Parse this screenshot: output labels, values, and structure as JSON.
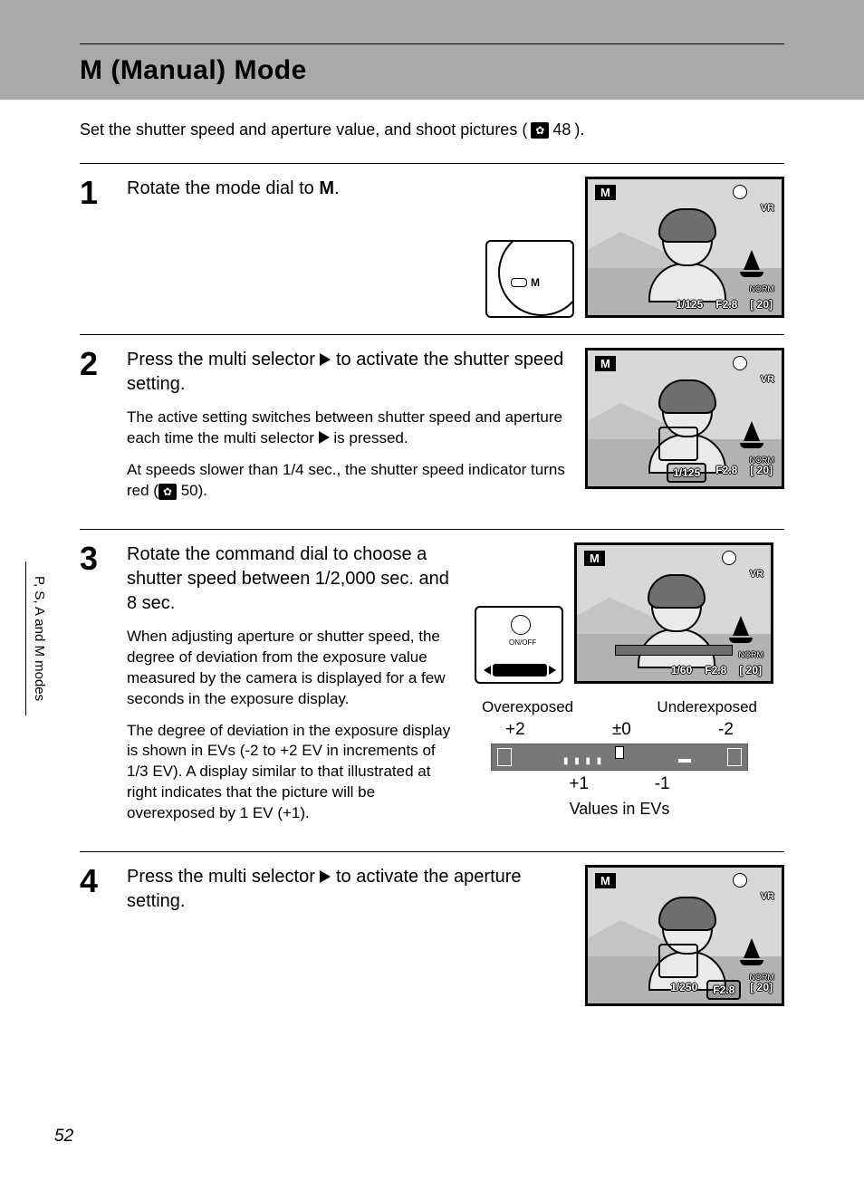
{
  "page": {
    "title": "M (Manual) Mode",
    "intro_a": "Set the shutter speed and aperture value, and shoot pictures (",
    "intro_ref": "48",
    "intro_b": ").",
    "side_tab": "P, S, A and M modes",
    "page_number": "52"
  },
  "steps": [
    {
      "num": "1",
      "title_a": "Rotate the mode dial to ",
      "title_bold": "M",
      "title_b": ".",
      "lcd": {
        "mode": "M",
        "shutter": "1/125",
        "aperture": "F2.8",
        "remain": "20",
        "vr": "VR",
        "norm": "NORM"
      }
    },
    {
      "num": "2",
      "title_a": "Press the multi selector ",
      "title_b": " to activate the shutter speed setting.",
      "desc1_a": "The active setting switches between shutter speed and aperture each time the multi selector ",
      "desc1_b": " is pressed.",
      "desc2_a": "At speeds slower than 1/4 sec., the shutter speed indicator turns red (",
      "desc2_ref": "50",
      "desc2_b": ").",
      "lcd": {
        "mode": "M",
        "shutter": "1/125",
        "aperture": "F2.8",
        "remain": "20",
        "vr": "VR",
        "norm": "NORM",
        "shutter_boxed": true
      }
    },
    {
      "num": "3",
      "title": "Rotate the command dial to choose a shutter speed between 1/2,000 sec. and 8 sec.",
      "desc1": "When adjusting aperture or shutter speed, the degree of deviation from the exposure value measured by the camera is displayed for a few seconds in the exposure display.",
      "desc2": "The degree of deviation in the exposure display is shown in EVs (-2 to +2 EV in increments of 1/3 EV). A display similar to that illustrated at right indicates that the picture will be overexposed by 1 EV (+1).",
      "cmd_label": "ON/OFF",
      "lcd": {
        "mode": "M",
        "shutter": "1/60",
        "aperture": "F2.8",
        "remain": "20",
        "vr": "VR",
        "norm": "NORM",
        "ev_strip": true
      }
    },
    {
      "num": "4",
      "title_a": "Press the multi selector ",
      "title_b": " to activate the aperture setting.",
      "lcd": {
        "mode": "M",
        "shutter": "1/250",
        "aperture": "F2.8",
        "remain": "20",
        "vr": "VR",
        "norm": "NORM",
        "aperture_boxed": true
      }
    }
  ],
  "ev": {
    "over": "Overexposed",
    "under": "Underexposed",
    "p2": "+2",
    "z": "±0",
    "m2": "-2",
    "p1": "+1",
    "m1": "-1",
    "caption": "Values in EVs"
  }
}
